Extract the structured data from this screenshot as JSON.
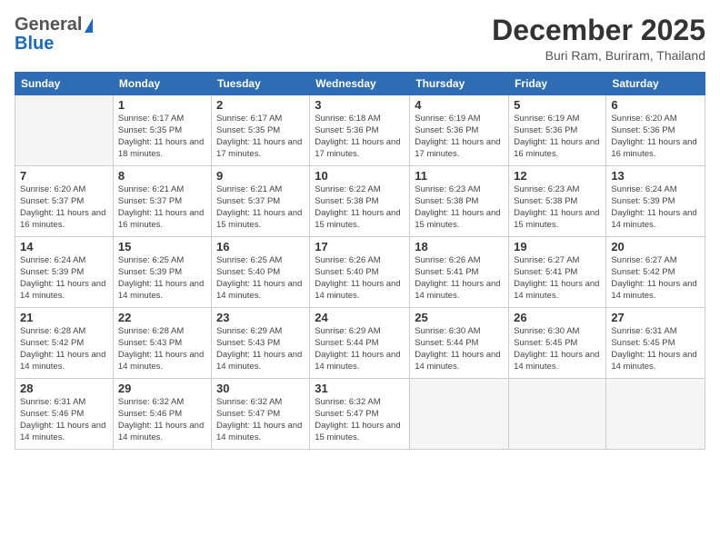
{
  "header": {
    "logo_general": "General",
    "logo_blue": "Blue",
    "month_title": "December 2025",
    "location": "Buri Ram, Buriram, Thailand"
  },
  "weekdays": [
    "Sunday",
    "Monday",
    "Tuesday",
    "Wednesday",
    "Thursday",
    "Friday",
    "Saturday"
  ],
  "weeks": [
    [
      {
        "day": "",
        "info": ""
      },
      {
        "day": "1",
        "info": "Sunrise: 6:17 AM\nSunset: 5:35 PM\nDaylight: 11 hours\nand 18 minutes."
      },
      {
        "day": "2",
        "info": "Sunrise: 6:17 AM\nSunset: 5:35 PM\nDaylight: 11 hours\nand 17 minutes."
      },
      {
        "day": "3",
        "info": "Sunrise: 6:18 AM\nSunset: 5:36 PM\nDaylight: 11 hours\nand 17 minutes."
      },
      {
        "day": "4",
        "info": "Sunrise: 6:19 AM\nSunset: 5:36 PM\nDaylight: 11 hours\nand 17 minutes."
      },
      {
        "day": "5",
        "info": "Sunrise: 6:19 AM\nSunset: 5:36 PM\nDaylight: 11 hours\nand 16 minutes."
      },
      {
        "day": "6",
        "info": "Sunrise: 6:20 AM\nSunset: 5:36 PM\nDaylight: 11 hours\nand 16 minutes."
      }
    ],
    [
      {
        "day": "7",
        "info": "Sunrise: 6:20 AM\nSunset: 5:37 PM\nDaylight: 11 hours\nand 16 minutes."
      },
      {
        "day": "8",
        "info": "Sunrise: 6:21 AM\nSunset: 5:37 PM\nDaylight: 11 hours\nand 16 minutes."
      },
      {
        "day": "9",
        "info": "Sunrise: 6:21 AM\nSunset: 5:37 PM\nDaylight: 11 hours\nand 15 minutes."
      },
      {
        "day": "10",
        "info": "Sunrise: 6:22 AM\nSunset: 5:38 PM\nDaylight: 11 hours\nand 15 minutes."
      },
      {
        "day": "11",
        "info": "Sunrise: 6:23 AM\nSunset: 5:38 PM\nDaylight: 11 hours\nand 15 minutes."
      },
      {
        "day": "12",
        "info": "Sunrise: 6:23 AM\nSunset: 5:38 PM\nDaylight: 11 hours\nand 15 minutes."
      },
      {
        "day": "13",
        "info": "Sunrise: 6:24 AM\nSunset: 5:39 PM\nDaylight: 11 hours\nand 14 minutes."
      }
    ],
    [
      {
        "day": "14",
        "info": "Sunrise: 6:24 AM\nSunset: 5:39 PM\nDaylight: 11 hours\nand 14 minutes."
      },
      {
        "day": "15",
        "info": "Sunrise: 6:25 AM\nSunset: 5:39 PM\nDaylight: 11 hours\nand 14 minutes."
      },
      {
        "day": "16",
        "info": "Sunrise: 6:25 AM\nSunset: 5:40 PM\nDaylight: 11 hours\nand 14 minutes."
      },
      {
        "day": "17",
        "info": "Sunrise: 6:26 AM\nSunset: 5:40 PM\nDaylight: 11 hours\nand 14 minutes."
      },
      {
        "day": "18",
        "info": "Sunrise: 6:26 AM\nSunset: 5:41 PM\nDaylight: 11 hours\nand 14 minutes."
      },
      {
        "day": "19",
        "info": "Sunrise: 6:27 AM\nSunset: 5:41 PM\nDaylight: 11 hours\nand 14 minutes."
      },
      {
        "day": "20",
        "info": "Sunrise: 6:27 AM\nSunset: 5:42 PM\nDaylight: 11 hours\nand 14 minutes."
      }
    ],
    [
      {
        "day": "21",
        "info": "Sunrise: 6:28 AM\nSunset: 5:42 PM\nDaylight: 11 hours\nand 14 minutes."
      },
      {
        "day": "22",
        "info": "Sunrise: 6:28 AM\nSunset: 5:43 PM\nDaylight: 11 hours\nand 14 minutes."
      },
      {
        "day": "23",
        "info": "Sunrise: 6:29 AM\nSunset: 5:43 PM\nDaylight: 11 hours\nand 14 minutes."
      },
      {
        "day": "24",
        "info": "Sunrise: 6:29 AM\nSunset: 5:44 PM\nDaylight: 11 hours\nand 14 minutes."
      },
      {
        "day": "25",
        "info": "Sunrise: 6:30 AM\nSunset: 5:44 PM\nDaylight: 11 hours\nand 14 minutes."
      },
      {
        "day": "26",
        "info": "Sunrise: 6:30 AM\nSunset: 5:45 PM\nDaylight: 11 hours\nand 14 minutes."
      },
      {
        "day": "27",
        "info": "Sunrise: 6:31 AM\nSunset: 5:45 PM\nDaylight: 11 hours\nand 14 minutes."
      }
    ],
    [
      {
        "day": "28",
        "info": "Sunrise: 6:31 AM\nSunset: 5:46 PM\nDaylight: 11 hours\nand 14 minutes."
      },
      {
        "day": "29",
        "info": "Sunrise: 6:32 AM\nSunset: 5:46 PM\nDaylight: 11 hours\nand 14 minutes."
      },
      {
        "day": "30",
        "info": "Sunrise: 6:32 AM\nSunset: 5:47 PM\nDaylight: 11 hours\nand 14 minutes."
      },
      {
        "day": "31",
        "info": "Sunrise: 6:32 AM\nSunset: 5:47 PM\nDaylight: 11 hours\nand 15 minutes."
      },
      {
        "day": "",
        "info": ""
      },
      {
        "day": "",
        "info": ""
      },
      {
        "day": "",
        "info": ""
      }
    ]
  ]
}
